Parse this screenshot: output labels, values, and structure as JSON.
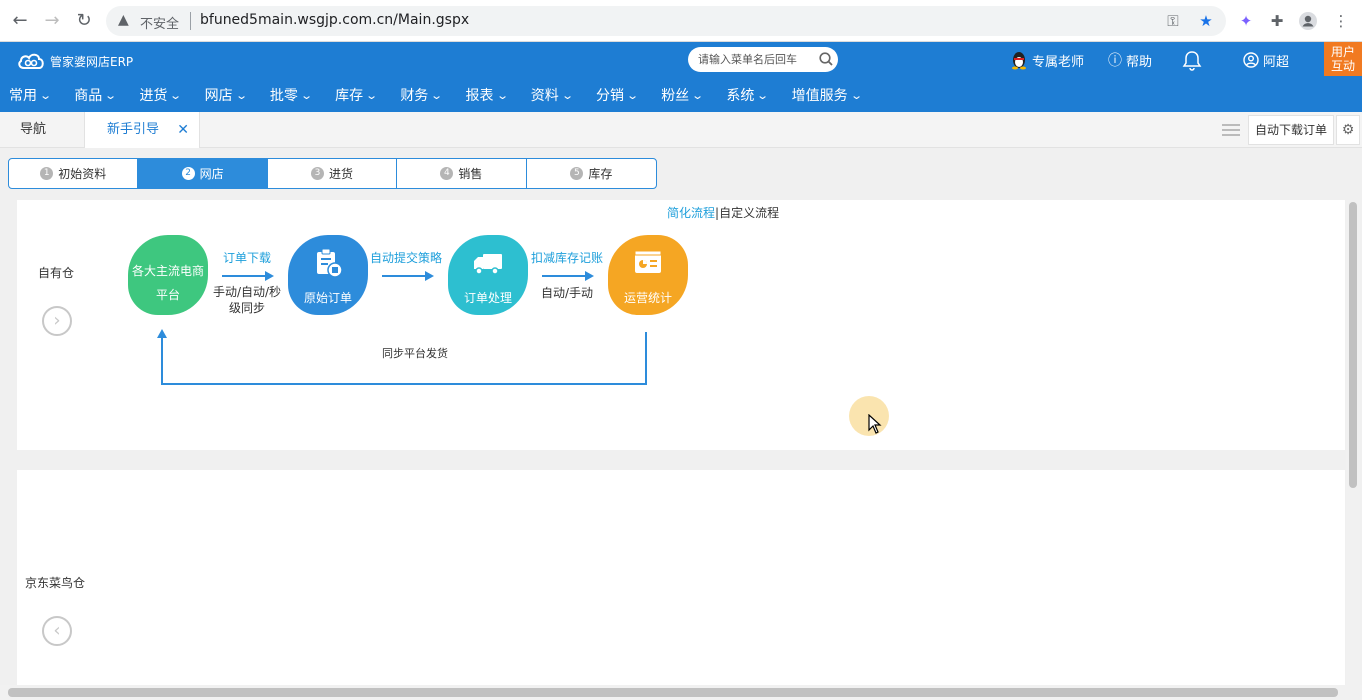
{
  "browser": {
    "security_label": "不安全",
    "url": "bfuned5main.wsgjp.com.cn/Main.gspx"
  },
  "header": {
    "logo_text": "管家婆网店ERP",
    "search_placeholder": "请输入菜单名后回车",
    "teacher": "专属老师",
    "help": "帮助",
    "user": "阿超",
    "feedback_line1": "用户",
    "feedback_line2": "互动"
  },
  "menu": [
    {
      "label": "常用"
    },
    {
      "label": "商品"
    },
    {
      "label": "进货"
    },
    {
      "label": "网店"
    },
    {
      "label": "批零"
    },
    {
      "label": "库存"
    },
    {
      "label": "财务"
    },
    {
      "label": "报表"
    },
    {
      "label": "资料"
    },
    {
      "label": "分销"
    },
    {
      "label": "粉丝"
    },
    {
      "label": "系统"
    },
    {
      "label": "增值服务"
    }
  ],
  "tabs": {
    "nav": "导航",
    "guide": "新手引导",
    "auto_download": "自动下载订单"
  },
  "steps": [
    {
      "num": "1",
      "label": "初始资料"
    },
    {
      "num": "2",
      "label": "网店"
    },
    {
      "num": "3",
      "label": "进货"
    },
    {
      "num": "4",
      "label": "销售"
    },
    {
      "num": "5",
      "label": "库存"
    }
  ],
  "flow": {
    "link_simple": "简化流程",
    "link_sep": "|",
    "link_custom": "自定义流程",
    "warehouse1": "自有仓",
    "warehouse2": "京东菜鸟仓",
    "node1_line1": "各大主流电商",
    "node1_line2": "平台",
    "node2": "原始订单",
    "node3": "订单处理",
    "node4": "运营统计",
    "arrow1_top": "订单下载",
    "arrow1_bottom_l1": "手动/自动/秒",
    "arrow1_bottom_l2": "级同步",
    "arrow2_top": "自动提交策略",
    "arrow3_top": "扣减库存记账",
    "arrow3_bottom": "自动/手动",
    "sync": "同步平台发货"
  },
  "colors": {
    "brand_blue": "#1e7dd3",
    "green": "#3ec77f",
    "blue": "#2d8cdb",
    "teal": "#2dbfd0",
    "orange": "#f5a623",
    "feedback": "#f17a21",
    "link": "#1e9fdb"
  }
}
